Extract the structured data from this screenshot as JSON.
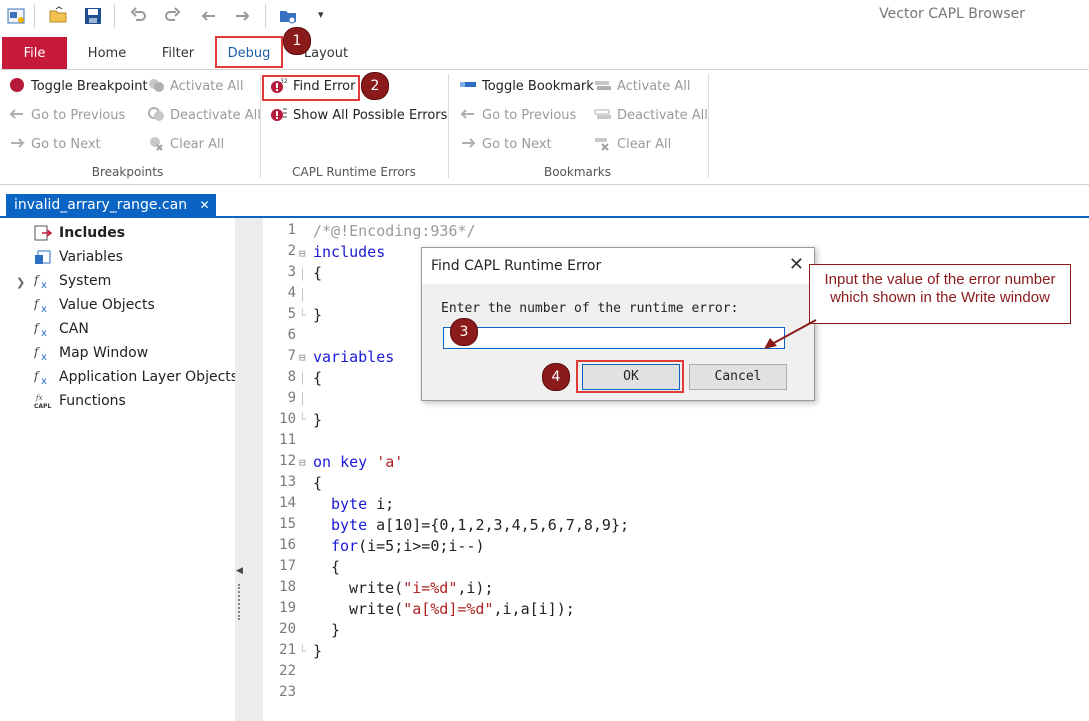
{
  "app": {
    "title": "Vector CAPL Browser"
  },
  "tabs": [
    {
      "label": "File"
    },
    {
      "label": "Home"
    },
    {
      "label": "Filter"
    },
    {
      "label": "Debug"
    },
    {
      "label": "Layout"
    }
  ],
  "ribbon": {
    "breakpoints": {
      "group_label": "Breakpoints",
      "toggle": "Toggle Breakpoint",
      "activate_all": "Activate All",
      "go_previous": "Go to Previous",
      "deactivate_all": "Deactivate All",
      "go_next": "Go to Next",
      "clear_all": "Clear All"
    },
    "runtime_errors": {
      "group_label": "CAPL Runtime Errors",
      "find_error": "Find Error",
      "show_all": "Show All Possible Errors"
    },
    "bookmarks": {
      "group_label": "Bookmarks",
      "toggle": "Toggle Bookmark",
      "activate_all": "Activate All",
      "go_previous": "Go to Previous",
      "deactivate_all": "Deactivate All",
      "go_next": "Go to Next",
      "clear_all": "Clear All"
    }
  },
  "document_tab": {
    "label": "invalid_arrary_range.can",
    "close": "✕"
  },
  "tree": {
    "items": [
      {
        "label": "Includes",
        "icon": "includes-icon",
        "bold": true
      },
      {
        "label": "Variables",
        "icon": "variables-icon"
      },
      {
        "label": "System",
        "icon": "function-x-icon"
      },
      {
        "label": "Value Objects",
        "icon": "function-x-icon"
      },
      {
        "label": "CAN",
        "icon": "function-x-icon"
      },
      {
        "label": "Map Window",
        "icon": "function-x-icon"
      },
      {
        "label": "Application Layer Objects",
        "icon": "function-x-icon"
      },
      {
        "label": "Functions",
        "icon": "capl-functions-icon"
      }
    ]
  },
  "editor": {
    "line_numbers": [
      "1",
      "2",
      "3",
      "4",
      "5",
      "6",
      "7",
      "8",
      "9",
      "10",
      "11",
      "12",
      "13",
      "14",
      "15",
      "16",
      "17",
      "18",
      "19",
      "20",
      "21",
      "22",
      "23"
    ],
    "lines": {
      "l1": "/*@!Encoding:936*/",
      "l2": "includes",
      "l3": "{",
      "l5": "}",
      "l7": "variables",
      "l8": "{",
      "l10": "}",
      "l12a": "on key ",
      "l12b": "'a'",
      "l13": "{",
      "l14a": "byte",
      "l14b": " i;",
      "l15a": "byte",
      "l15b": " a[10]={0,1,2,3,4,5,6,7,8,9};",
      "l16a": "for",
      "l16b": "(i=5;i>=0;i--)",
      "l17": "{",
      "l18a": "write(",
      "l18b": "\"i=%d\"",
      "l18c": ",i);",
      "l19a": "write(",
      "l19b": "\"a[%d]=%d\"",
      "l19c": ",i,a[i]);",
      "l20": "}",
      "l21": "}"
    }
  },
  "dialog": {
    "title": "Find CAPL Runtime Error",
    "close": "✕",
    "prompt": "Enter the number of the runtime error:",
    "input_value": "",
    "ok_label": "OK",
    "cancel_label": "Cancel"
  },
  "callout": {
    "text_line1": "Input the value of the error number",
    "text_line2": "which shown in the Write window"
  },
  "badges": [
    "1",
    "2",
    "3",
    "4"
  ],
  "colors": {
    "accent": "#0a64c4",
    "file_tab": "#c51a3a",
    "highlight": "#e03a3a",
    "badge": "#8b1a1a"
  }
}
